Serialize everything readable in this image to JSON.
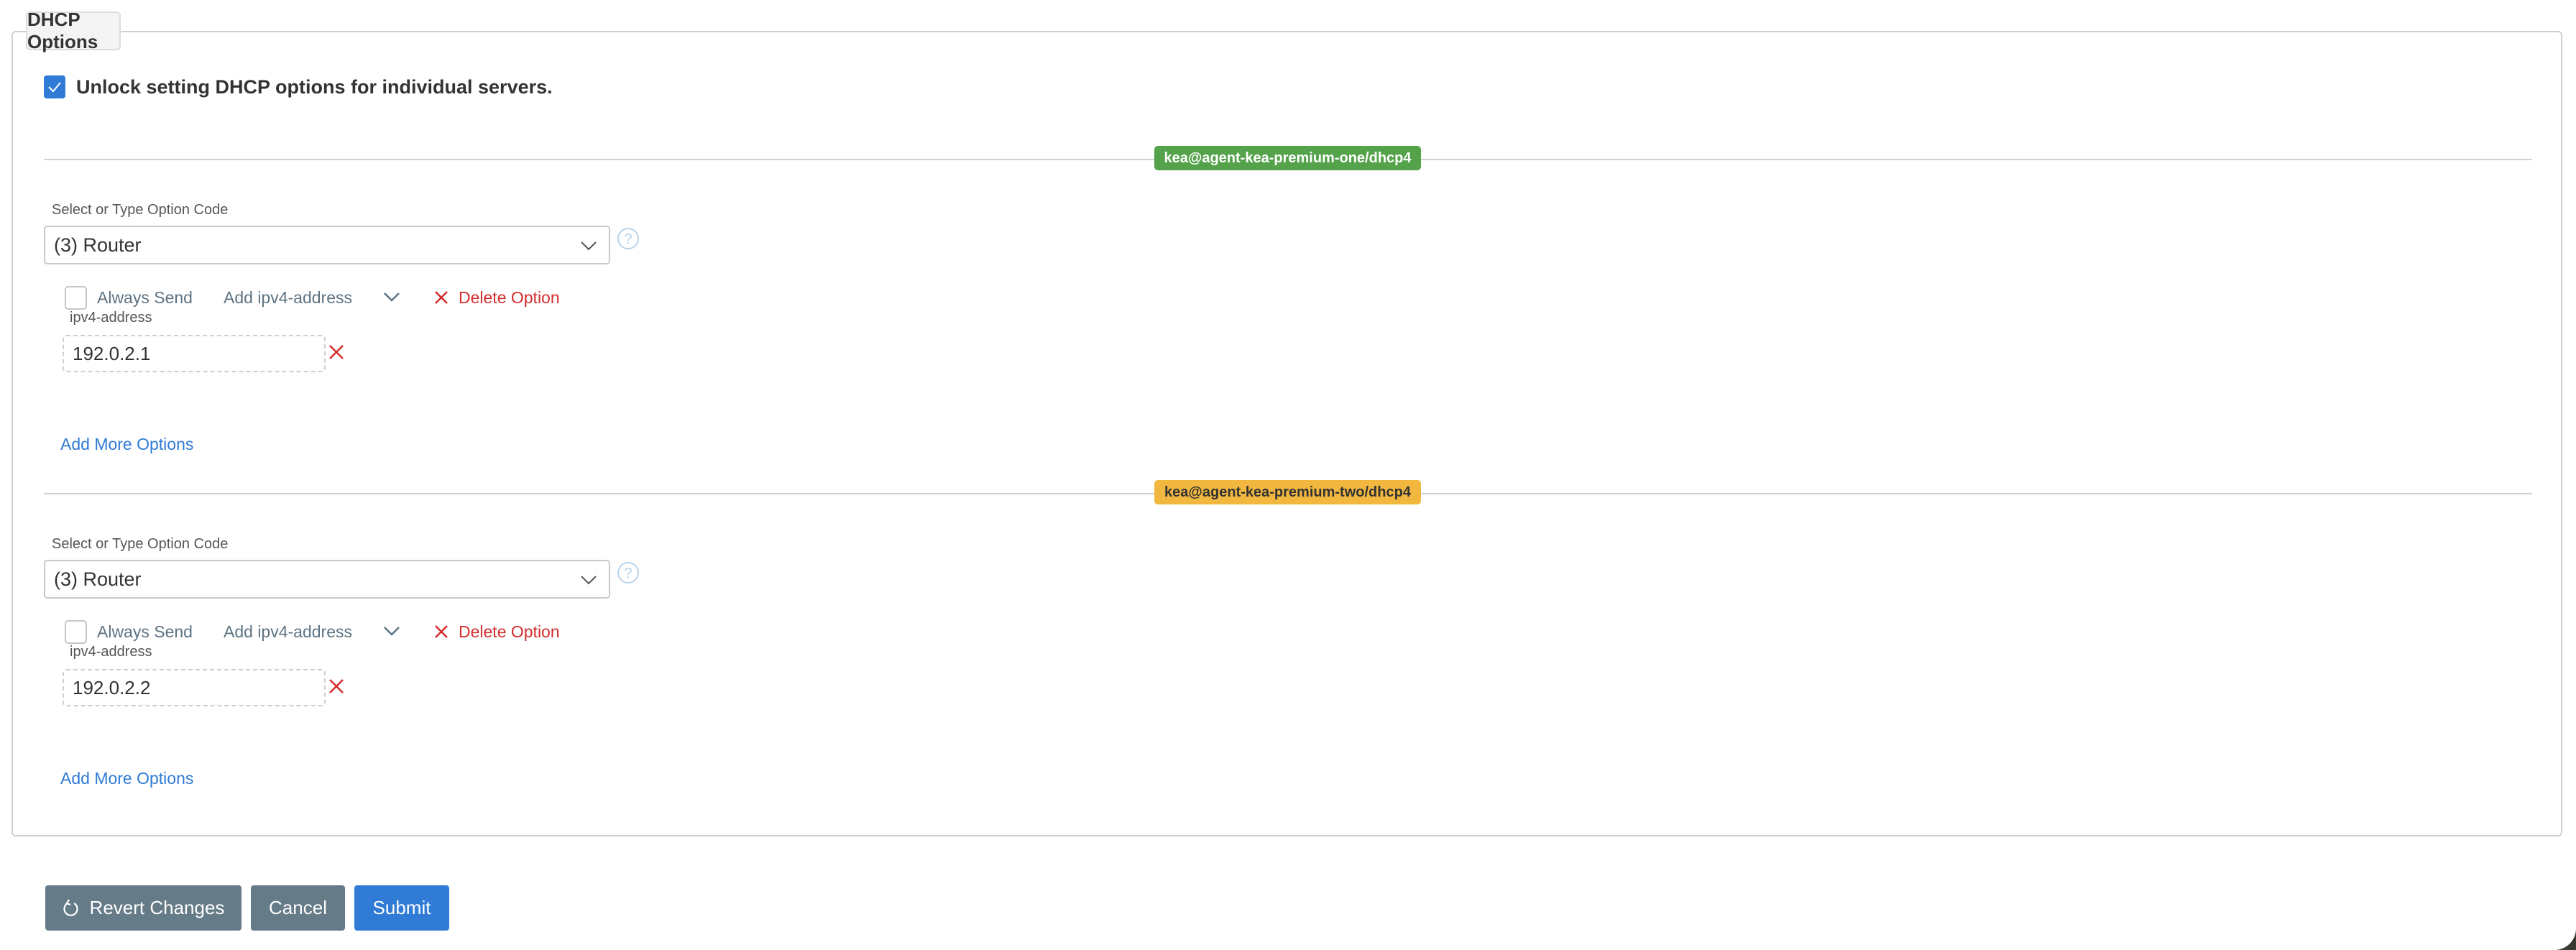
{
  "fieldset": {
    "legend": "DHCP Options",
    "unlock_checkbox": {
      "label": "Unlock setting DHCP options for individual servers.",
      "checked": true
    }
  },
  "servers": [
    {
      "badge": "kea@agent-kea-premium-one/dhcp4",
      "badge_color": "#54a24a",
      "option_code_label": "Select or Type Option Code",
      "option_code_value": "(3) Router",
      "always_send_label": "Always Send",
      "always_send_checked": false,
      "add_field_label": "Add ipv4-address",
      "delete_label": "Delete Option",
      "fields": [
        {
          "label": "ipv4-address",
          "value": "192.0.2.1"
        }
      ],
      "add_more_label": "Add More Options"
    },
    {
      "badge": "kea@agent-kea-premium-two/dhcp4",
      "badge_color": "#f2b73f",
      "option_code_label": "Select or Type Option Code",
      "option_code_value": "(3) Router",
      "always_send_label": "Always Send",
      "always_send_checked": false,
      "add_field_label": "Add ipv4-address",
      "delete_label": "Delete Option",
      "fields": [
        {
          "label": "ipv4-address",
          "value": "192.0.2.2"
        }
      ],
      "add_more_label": "Add More Options"
    }
  ],
  "actions": {
    "revert_label": "Revert Changes",
    "cancel_label": "Cancel",
    "submit_label": "Submit"
  },
  "icons": {
    "checkbox": "check-icon",
    "select_toggle": "chevron-down-icon",
    "help": "question-circle-icon",
    "delete": "x-icon",
    "revert": "undo-icon"
  },
  "colors": {
    "primary": "#2f7bd6",
    "secondary": "#657b87",
    "danger": "#d42d2d"
  }
}
